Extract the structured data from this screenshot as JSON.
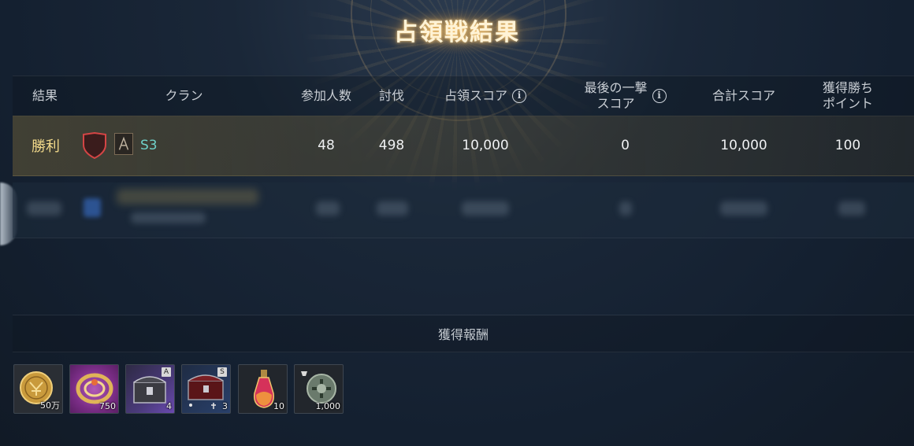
{
  "title": "占領戦結果",
  "columns": {
    "result": "結果",
    "clan": "クラン",
    "participants": "参加人数",
    "kills": "討伐",
    "occupation_score": "占領スコア",
    "last_hit_score_line1": "最後の一撃",
    "last_hit_score_line2": "スコア",
    "total_score": "合計スコア",
    "win_points_line1": "獲得勝ち",
    "win_points_line2": "ポイント"
  },
  "rows": [
    {
      "result": "勝利",
      "clan_name": "S3",
      "participants": "48",
      "kills": "498",
      "occupation_score": "10,000",
      "last_hit_score": "0",
      "total_score": "10,000",
      "win_points": "100"
    }
  ],
  "rewards": {
    "label": "獲得報酬",
    "items": [
      {
        "icon": "gold-coin-icon",
        "count": "50万"
      },
      {
        "icon": "golden-ring-icon",
        "count": "750"
      },
      {
        "icon": "treasure-chest-icon",
        "count": "4",
        "rank": "A"
      },
      {
        "icon": "red-chest-icon",
        "count": "3",
        "rank": "S"
      },
      {
        "icon": "potion-icon",
        "count": "10"
      },
      {
        "icon": "silver-coin-icon",
        "count": "1,000"
      }
    ]
  },
  "colors": {
    "victory_text": "#f2d98a",
    "clan_name": "#6fd0c8",
    "shield": "#c53a3a"
  }
}
